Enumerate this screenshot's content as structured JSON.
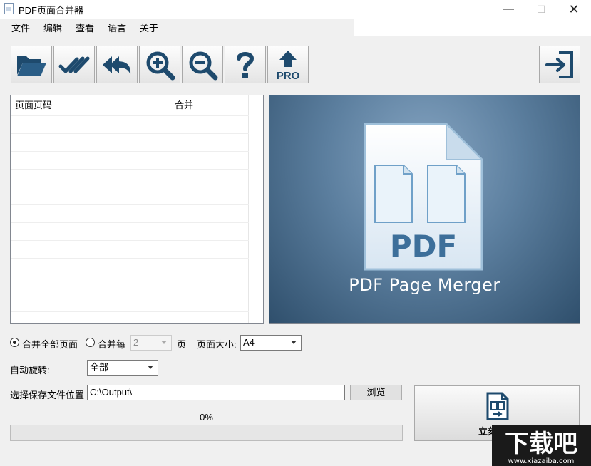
{
  "window": {
    "title": "PDF页面合并器"
  },
  "menu": [
    "文件",
    "编辑",
    "查看",
    "语言",
    "关于"
  ],
  "toolbar": [
    {
      "name": "open-button",
      "icon": "folder-open-icon"
    },
    {
      "name": "select-all-button",
      "icon": "double-check-icon"
    },
    {
      "name": "undo-all-button",
      "icon": "reply-all-icon"
    },
    {
      "name": "zoom-in-button",
      "icon": "zoom-in-icon"
    },
    {
      "name": "zoom-out-button",
      "icon": "zoom-out-icon"
    },
    {
      "name": "help-button",
      "icon": "question-mark-icon"
    },
    {
      "name": "upgrade-pro-button",
      "icon": "upgrade-pro-icon",
      "label": "PRO"
    },
    {
      "name": "exit-button",
      "icon": "exit-icon"
    }
  ],
  "page_list": {
    "columns": [
      "页面页码",
      "合并"
    ],
    "rows": []
  },
  "preview": {
    "logo_text": "PDF",
    "caption": "PDF Page Merger"
  },
  "options": {
    "merge_all_label": "合并全部页面",
    "merge_all_selected": true,
    "merge_every_label": "合并每",
    "merge_every_value": "2",
    "merge_every_unit": "页",
    "page_size_label": "页面大小:",
    "page_size_value": "A4",
    "auto_rotate_label": "自动旋转:",
    "auto_rotate_value": "全部",
    "save_location_label": "选择保存文件位置",
    "save_location_value": "C:\\Output\\",
    "browse_label": "浏览"
  },
  "progress": {
    "percent_text": "0%",
    "value": 0
  },
  "start_button": {
    "label": "立刻开始",
    "icon": "merge-pdf-icon"
  },
  "watermark": {
    "text": "下载吧",
    "subtext": "www.xiazaiba.com"
  },
  "colors": {
    "preview_bg": "#4a6b8a",
    "progress_fill": "#06b025",
    "pdf_text": "#3d6f9a"
  }
}
